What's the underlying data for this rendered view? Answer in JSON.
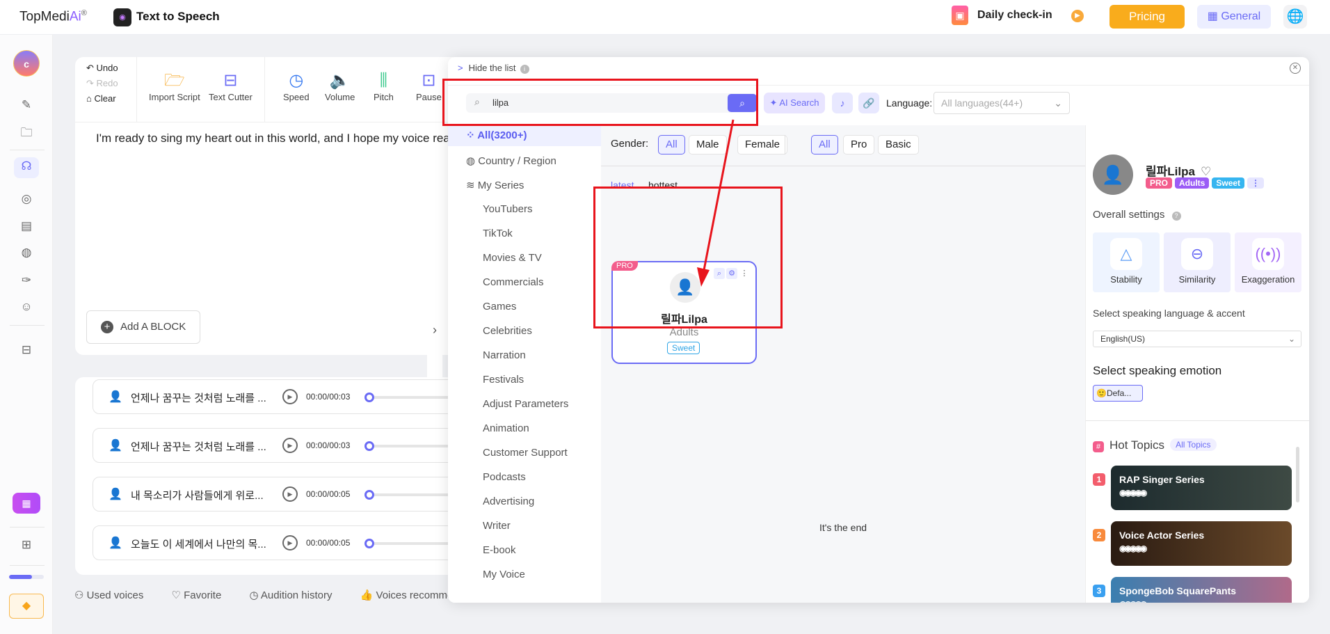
{
  "header": {
    "logo": "TopMedi",
    "logo_ai": "Ai",
    "logo_reg": "®",
    "app_title": "Text to Speech",
    "daily_checkin": "Daily check-in",
    "pricing": "Pricing",
    "general": "General"
  },
  "sidebar": {
    "avatar_letter": "c",
    "progress_percent": 65
  },
  "toolbar": {
    "undo": "Undo",
    "redo": "Redo",
    "clear": "Clear",
    "import_script": "Import Script",
    "text_cutter": "Text Cutter",
    "speed": "Speed",
    "volume": "Volume",
    "pitch": "Pitch",
    "pause": "Pause"
  },
  "editor": {
    "text": "I'm ready to sing my heart out in this world, and I hope my voice reaches",
    "add_block": "Add A BLOCK"
  },
  "audio_list": [
    {
      "text": "언제나 꿈꾸는 것처럼 노래를 ...",
      "time": "00:00/00:03"
    },
    {
      "text": "언제나 꿈꾸는 것처럼 노래를 ...",
      "time": "00:00/00:03"
    },
    {
      "text": "내 목소리가 사람들에게 위로...",
      "time": "00:00/00:05"
    },
    {
      "text": "오늘도 이 세계에서 나만의 목...",
      "time": "00:00/00:05"
    }
  ],
  "bottom_links": [
    "Used voices",
    "Favorite",
    "Audition history",
    "Voices recommended"
  ],
  "modal": {
    "hide_list": "Hide the list",
    "search_value": "lilpa",
    "ai_search": "AI Search",
    "language_label": "Language:",
    "language_placeholder": "All languages(44+)",
    "categories": {
      "all": "All(3200+)",
      "country": "Country / Region",
      "series": "My Series",
      "items": [
        "YouTubers",
        "TikTok",
        "Movies & TV",
        "Commercials",
        "Games",
        "Celebrities",
        "Narration",
        "Festivals",
        "Adjust Parameters",
        "Animation",
        "Customer Support",
        "Podcasts",
        "Advertising",
        "Writer",
        "E-book",
        "My Voice"
      ]
    },
    "filters": {
      "gender_label": "Gender:",
      "gender": [
        "All",
        "Male",
        "Female"
      ],
      "tier": [
        "All",
        "Pro",
        "Basic"
      ]
    },
    "sort": {
      "latest": "latest",
      "hottest": "hottest"
    },
    "card": {
      "badge": "PRO",
      "name": "릴파Lilpa",
      "category": "Adults",
      "tag": "Sweet"
    },
    "end_text": "It's the end"
  },
  "voice_panel": {
    "name": "릴파Lilpa",
    "tags": [
      {
        "label": "PRO",
        "color": "#f35d8c"
      },
      {
        "label": "Adults",
        "color": "#9b5cf6"
      },
      {
        "label": "Sweet",
        "color": "#36b5f0"
      }
    ],
    "overall_settings": "Overall settings",
    "settings": [
      "Stability",
      "Similarity",
      "Exaggeration"
    ],
    "language_label": "Select speaking language & accent",
    "language_value": "English(US)",
    "emotion_label": "Select speaking emotion",
    "emotion_value": "Defa...",
    "hot_topics": "Hot Topics",
    "all_topics": "All Topics",
    "topics": [
      {
        "rank": "1",
        "title": "RAP Singer Series",
        "color": "#f35d6c"
      },
      {
        "rank": "2",
        "title": "Voice Actor Series",
        "color": "#f88a3c"
      },
      {
        "rank": "3",
        "title": "SpongeBob SquarePants",
        "color": "#3aa0f0"
      }
    ]
  },
  "colors": {
    "accent": "#6a6bf5",
    "pricing": "#f9ac1c",
    "annotation": "#e8141c"
  }
}
